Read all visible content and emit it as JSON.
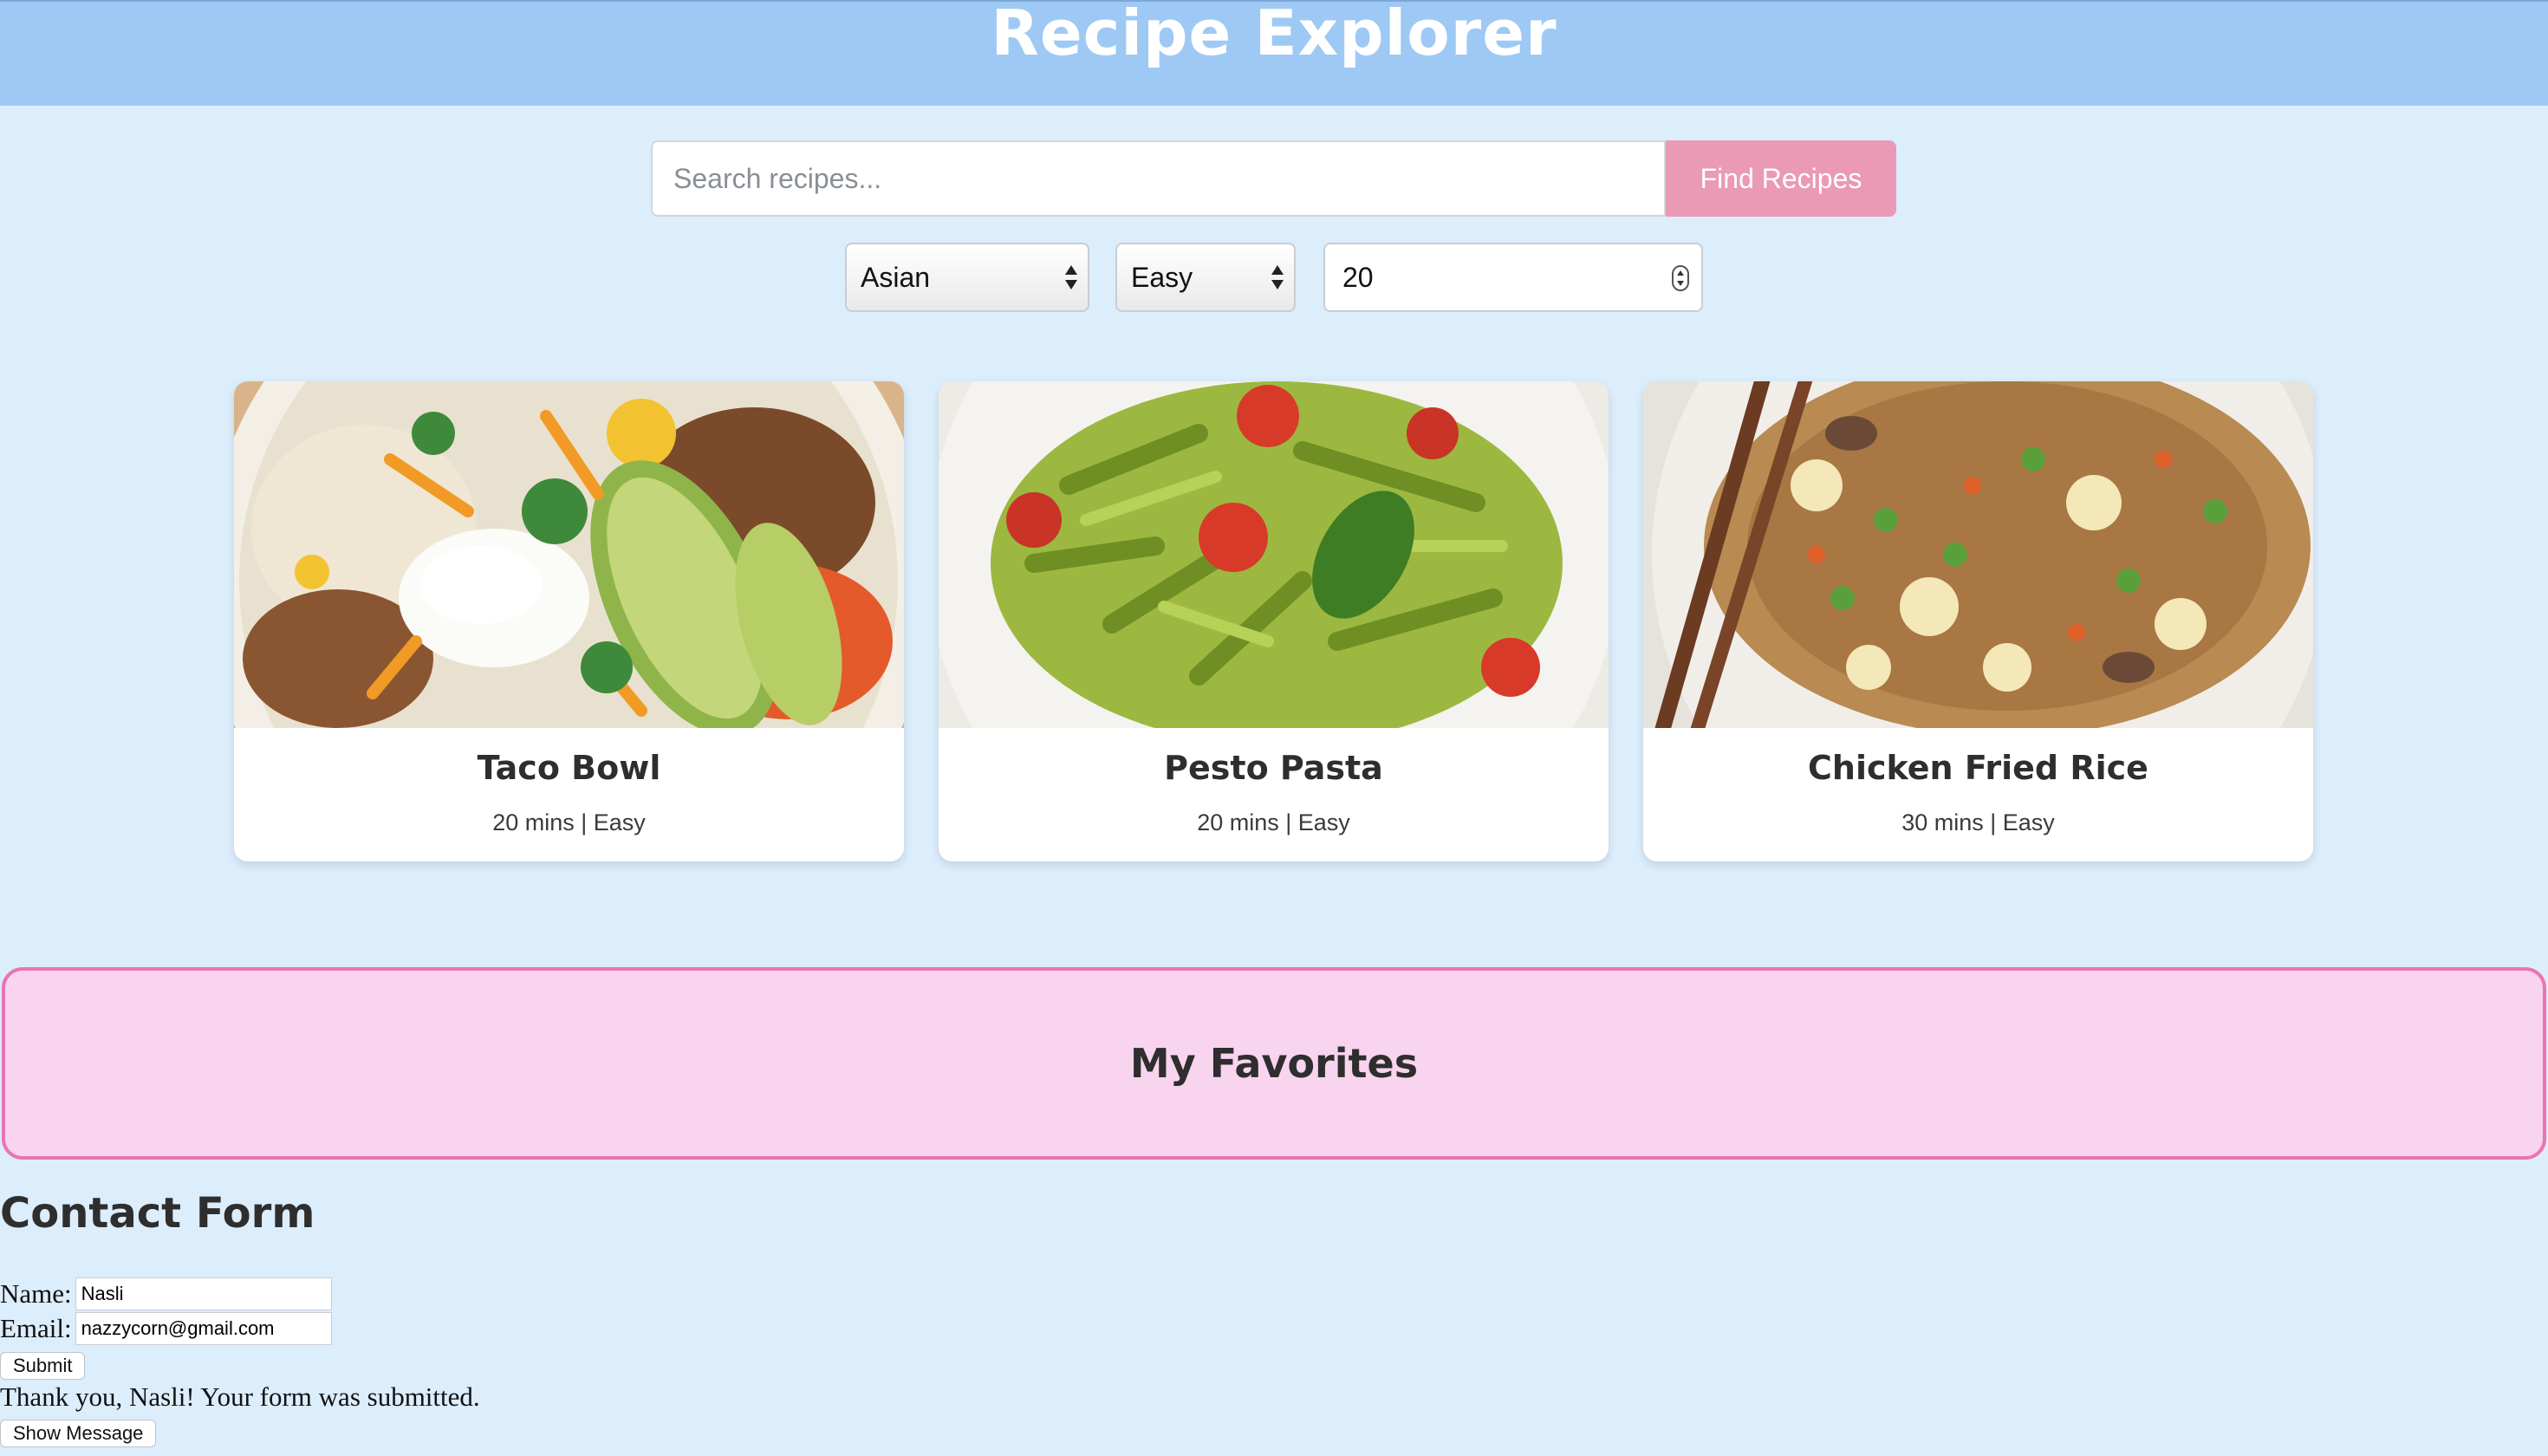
{
  "header": {
    "title": "Recipe Explorer"
  },
  "search": {
    "placeholder": "Search recipes...",
    "value": "",
    "button_label": "Find Recipes"
  },
  "filters": {
    "cuisine": "Asian",
    "difficulty": "Easy",
    "max_time": "20"
  },
  "recipes": [
    {
      "title": "Taco Bowl",
      "meta": "20 mins | Easy",
      "photo": "taco-bowl-photo"
    },
    {
      "title": "Pesto Pasta",
      "meta": "20 mins | Easy",
      "photo": "pesto-pasta-photo"
    },
    {
      "title": "Chicken Fried Rice",
      "meta": "30 mins | Easy",
      "photo": "chicken-fried-rice-photo"
    }
  ],
  "favorites": {
    "title": "My Favorites"
  },
  "contact": {
    "title": "Contact Form",
    "name_label": "Name:",
    "name_value": "Nasli",
    "email_label": "Email:",
    "email_value": "nazzycorn@gmail.com",
    "submit_label": "Submit",
    "thanks_message": "Thank you, Nasli! Your form was submitted.",
    "show_message_label": "Show Message"
  },
  "colors": {
    "header_bg": "#9ec9f5",
    "page_bg": "#dcedfc",
    "accent_pink": "#ea9ab4",
    "favorites_bg": "#f8d4ef",
    "favorites_border": "#ea74b4"
  }
}
